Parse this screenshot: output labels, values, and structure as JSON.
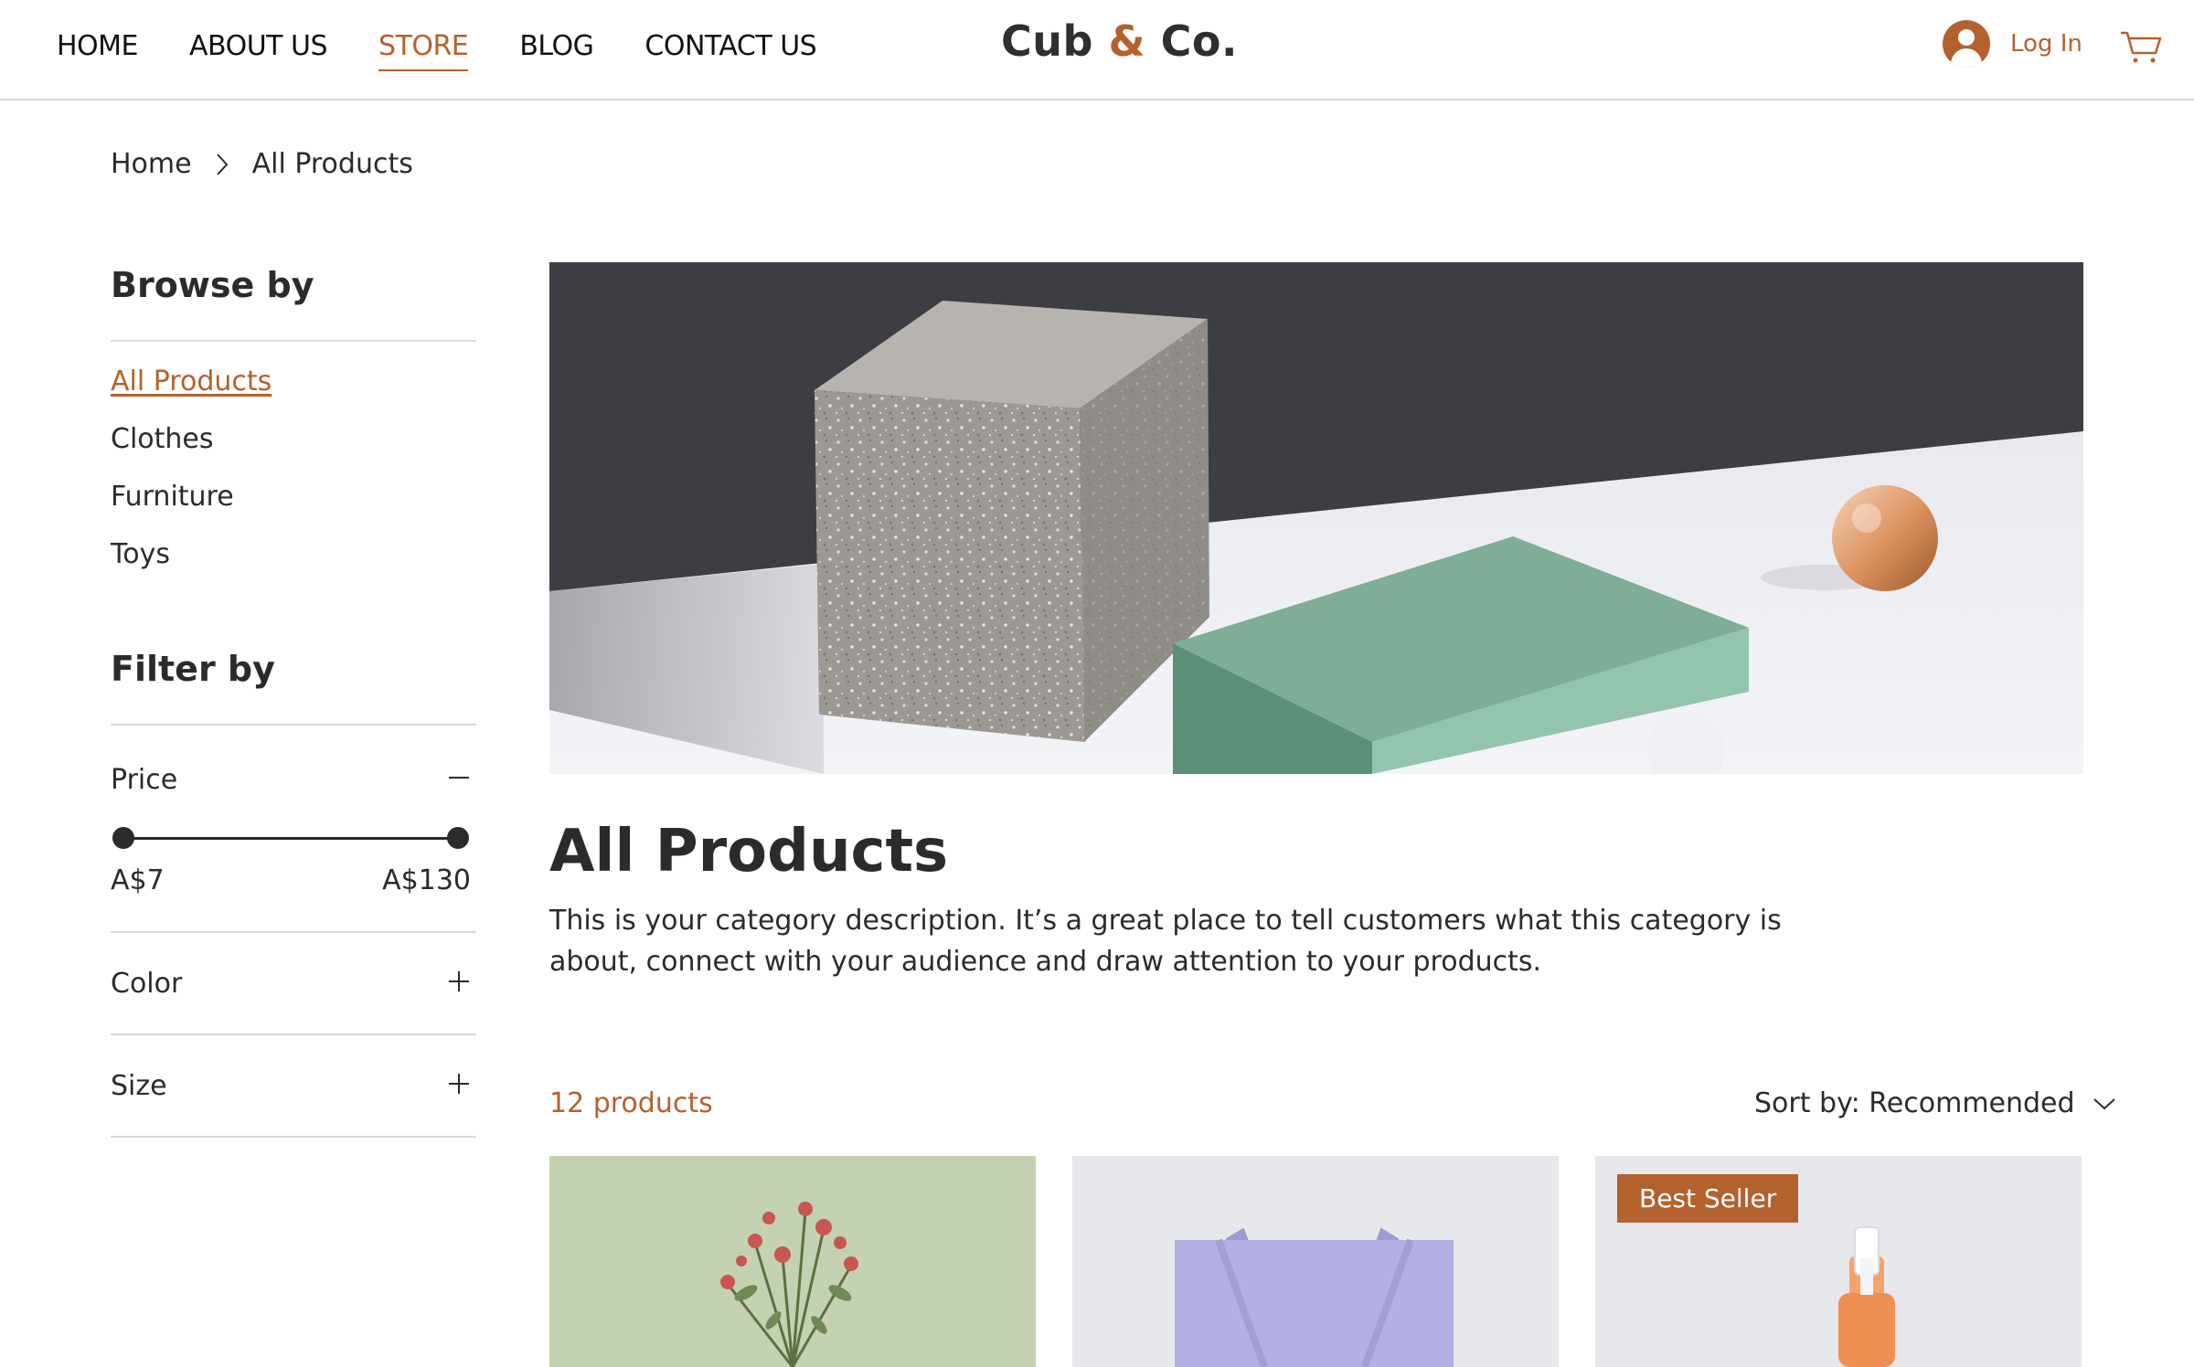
{
  "nav": {
    "items": [
      {
        "label": "HOME",
        "active": false
      },
      {
        "label": "ABOUT US",
        "active": false
      },
      {
        "label": "STORE",
        "active": true
      },
      {
        "label": "BLOG",
        "active": false
      },
      {
        "label": "CONTACT US",
        "active": false
      }
    ]
  },
  "brand": {
    "name_part1": "Cub",
    "amp": "&",
    "name_part2": "Co."
  },
  "header": {
    "login_label": "Log In",
    "accent_color": "#b4612d"
  },
  "breadcrumb": {
    "home": "Home",
    "current": "All Products"
  },
  "sidebar": {
    "browse_heading": "Browse by",
    "categories": [
      {
        "label": "All Products",
        "active": true
      },
      {
        "label": "Clothes",
        "active": false
      },
      {
        "label": "Furniture",
        "active": false
      },
      {
        "label": "Toys",
        "active": false
      }
    ],
    "filter_heading": "Filter by",
    "price": {
      "label": "Price",
      "min": "A$7",
      "max": "A$130"
    },
    "color_label": "Color",
    "size_label": "Size"
  },
  "main": {
    "title": "All Products",
    "description": "This is your category description. It’s a great place to tell customers what this category is about, connect with your audience and draw attention to your products.",
    "count_label": "12 products",
    "sort_label": "Sort by: Recommended",
    "products": [
      {
        "image": "dried-roses-bouquet",
        "badge": ""
      },
      {
        "image": "lilac-tote-bag",
        "badge": ""
      },
      {
        "image": "serum-dropper-bottle",
        "badge": "Best Seller"
      }
    ]
  }
}
